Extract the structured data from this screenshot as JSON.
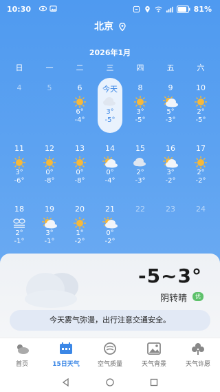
{
  "status": {
    "time": "10:30",
    "battery": "81%"
  },
  "location": {
    "city": "北京"
  },
  "calendar": {
    "month": "2026年1月",
    "weekdays": [
      "日",
      "一",
      "二",
      "三",
      "四",
      "五",
      "六"
    ],
    "rows": [
      [
        {
          "day": "4",
          "dim": true
        },
        {
          "day": "5",
          "dim": true
        },
        {
          "day": "6",
          "icon": "sunny",
          "hi": "6°",
          "lo": "-4°"
        },
        {
          "day": "今天",
          "icon": "cloudy",
          "hi": "3°",
          "lo": "-5°",
          "today": true
        },
        {
          "day": "8",
          "icon": "sunny",
          "hi": "3°",
          "lo": "-5°"
        },
        {
          "day": "9",
          "icon": "partly-cloudy",
          "hi": "5°",
          "lo": "-3°"
        },
        {
          "day": "10",
          "icon": "sunny",
          "hi": "2°",
          "lo": "-5°"
        }
      ],
      [
        {
          "day": "11",
          "icon": "sunny",
          "hi": "3°",
          "lo": "-6°"
        },
        {
          "day": "12",
          "icon": "sunny",
          "hi": "0°",
          "lo": "-8°"
        },
        {
          "day": "13",
          "icon": "sunny",
          "hi": "0°",
          "lo": "-8°"
        },
        {
          "day": "14",
          "icon": "partly-cloudy",
          "hi": "0°",
          "lo": "-4°"
        },
        {
          "day": "15",
          "icon": "cloudy",
          "hi": "2°",
          "lo": "-3°"
        },
        {
          "day": "16",
          "icon": "partly-cloudy",
          "hi": "3°",
          "lo": "-2°"
        },
        {
          "day": "17",
          "icon": "sunny",
          "hi": "2°",
          "lo": "-2°"
        }
      ],
      [
        {
          "day": "18",
          "icon": "haze",
          "hi": "2°",
          "lo": "-1°"
        },
        {
          "day": "19",
          "icon": "partly-cloudy",
          "hi": "3°",
          "lo": "-1°"
        },
        {
          "day": "20",
          "icon": "sunny",
          "hi": "1°",
          "lo": "-2°"
        },
        {
          "day": "21",
          "icon": "partly-cloudy",
          "hi": "0°",
          "lo": "-2°"
        },
        {
          "day": "22",
          "dim": true
        },
        {
          "day": "23",
          "dim": true
        },
        {
          "day": "24",
          "dim": true
        }
      ]
    ]
  },
  "today": {
    "temp_range": "-5~3°",
    "condition": "阴转晴",
    "air_quality": "优",
    "notice": "今天雾气弥漫，出行注意交通安全。"
  },
  "tabs": [
    {
      "label": "首页",
      "icon": "home-weather-icon"
    },
    {
      "label": "15日天气",
      "icon": "calendar-icon",
      "active": true
    },
    {
      "label": "空气质量",
      "icon": "air-icon"
    },
    {
      "label": "天气背景",
      "icon": "image-icon"
    },
    {
      "label": "天气许愿",
      "icon": "wish-icon"
    }
  ],
  "colors": {
    "sky": "#5ea3f1",
    "accent": "#3b87e6",
    "sun": "#f6b93b",
    "good_aq": "#5ec16b"
  }
}
